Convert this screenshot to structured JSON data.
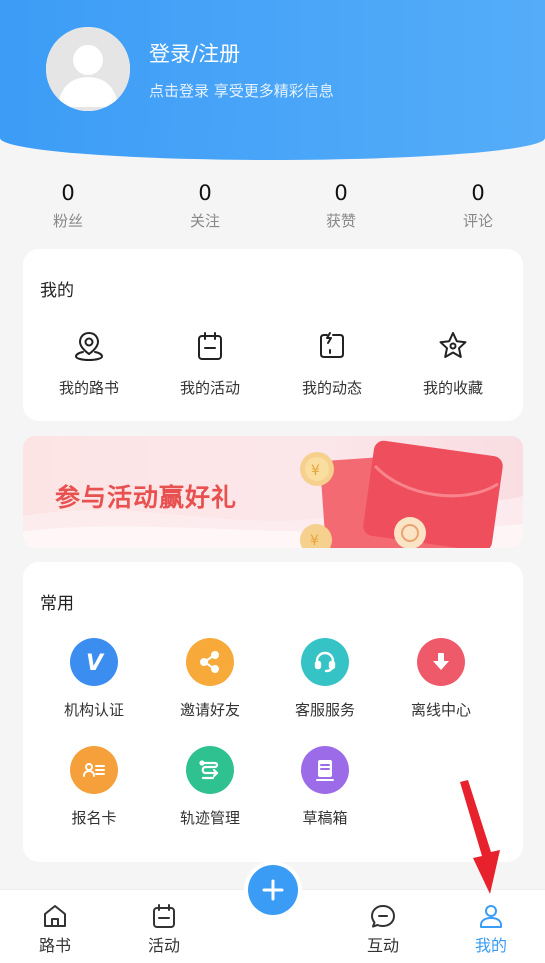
{
  "profile": {
    "login_title": "登录/注册",
    "login_subtitle": "点击登录 享受更多精彩信息"
  },
  "stats": [
    {
      "value": "0",
      "label": "粉丝"
    },
    {
      "value": "0",
      "label": "关注"
    },
    {
      "value": "0",
      "label": "获赞"
    },
    {
      "value": "0",
      "label": "评论"
    }
  ],
  "mine": {
    "title": "我的",
    "items": [
      {
        "label": "我的路书",
        "icon": "map-pin-icon"
      },
      {
        "label": "我的活动",
        "icon": "calendar-icon"
      },
      {
        "label": "我的动态",
        "icon": "dynamic-icon"
      },
      {
        "label": "我的收藏",
        "icon": "star-icon"
      }
    ]
  },
  "banner": {
    "text": "参与活动赢好礼"
  },
  "common": {
    "title": "常用",
    "items": [
      {
        "label": "机构认证",
        "icon": "verify-icon",
        "color": "#3b8df0"
      },
      {
        "label": "邀请好友",
        "icon": "share-icon",
        "color": "#f7a93a"
      },
      {
        "label": "客服服务",
        "icon": "headset-icon",
        "color": "#36c3c6"
      },
      {
        "label": "离线中心",
        "icon": "download-icon",
        "color": "#ee5a6a"
      },
      {
        "label": "报名卡",
        "icon": "card-icon",
        "color": "#f5a03b"
      },
      {
        "label": "轨迹管理",
        "icon": "track-icon",
        "color": "#2fc190"
      },
      {
        "label": "草稿箱",
        "icon": "draft-icon",
        "color": "#9b6be8"
      }
    ]
  },
  "tabs": [
    {
      "label": "路书",
      "icon": "home-icon"
    },
    {
      "label": "活动",
      "icon": "calendar-icon"
    },
    {
      "label": "互动",
      "icon": "chat-icon"
    },
    {
      "label": "我的",
      "icon": "user-icon",
      "active": true
    }
  ],
  "colors": {
    "primary": "#3a9cf5",
    "header_start": "#3c9cf6",
    "header_end": "#55adf9",
    "banner_text": "#e8514f",
    "arrow": "#e8222c"
  }
}
